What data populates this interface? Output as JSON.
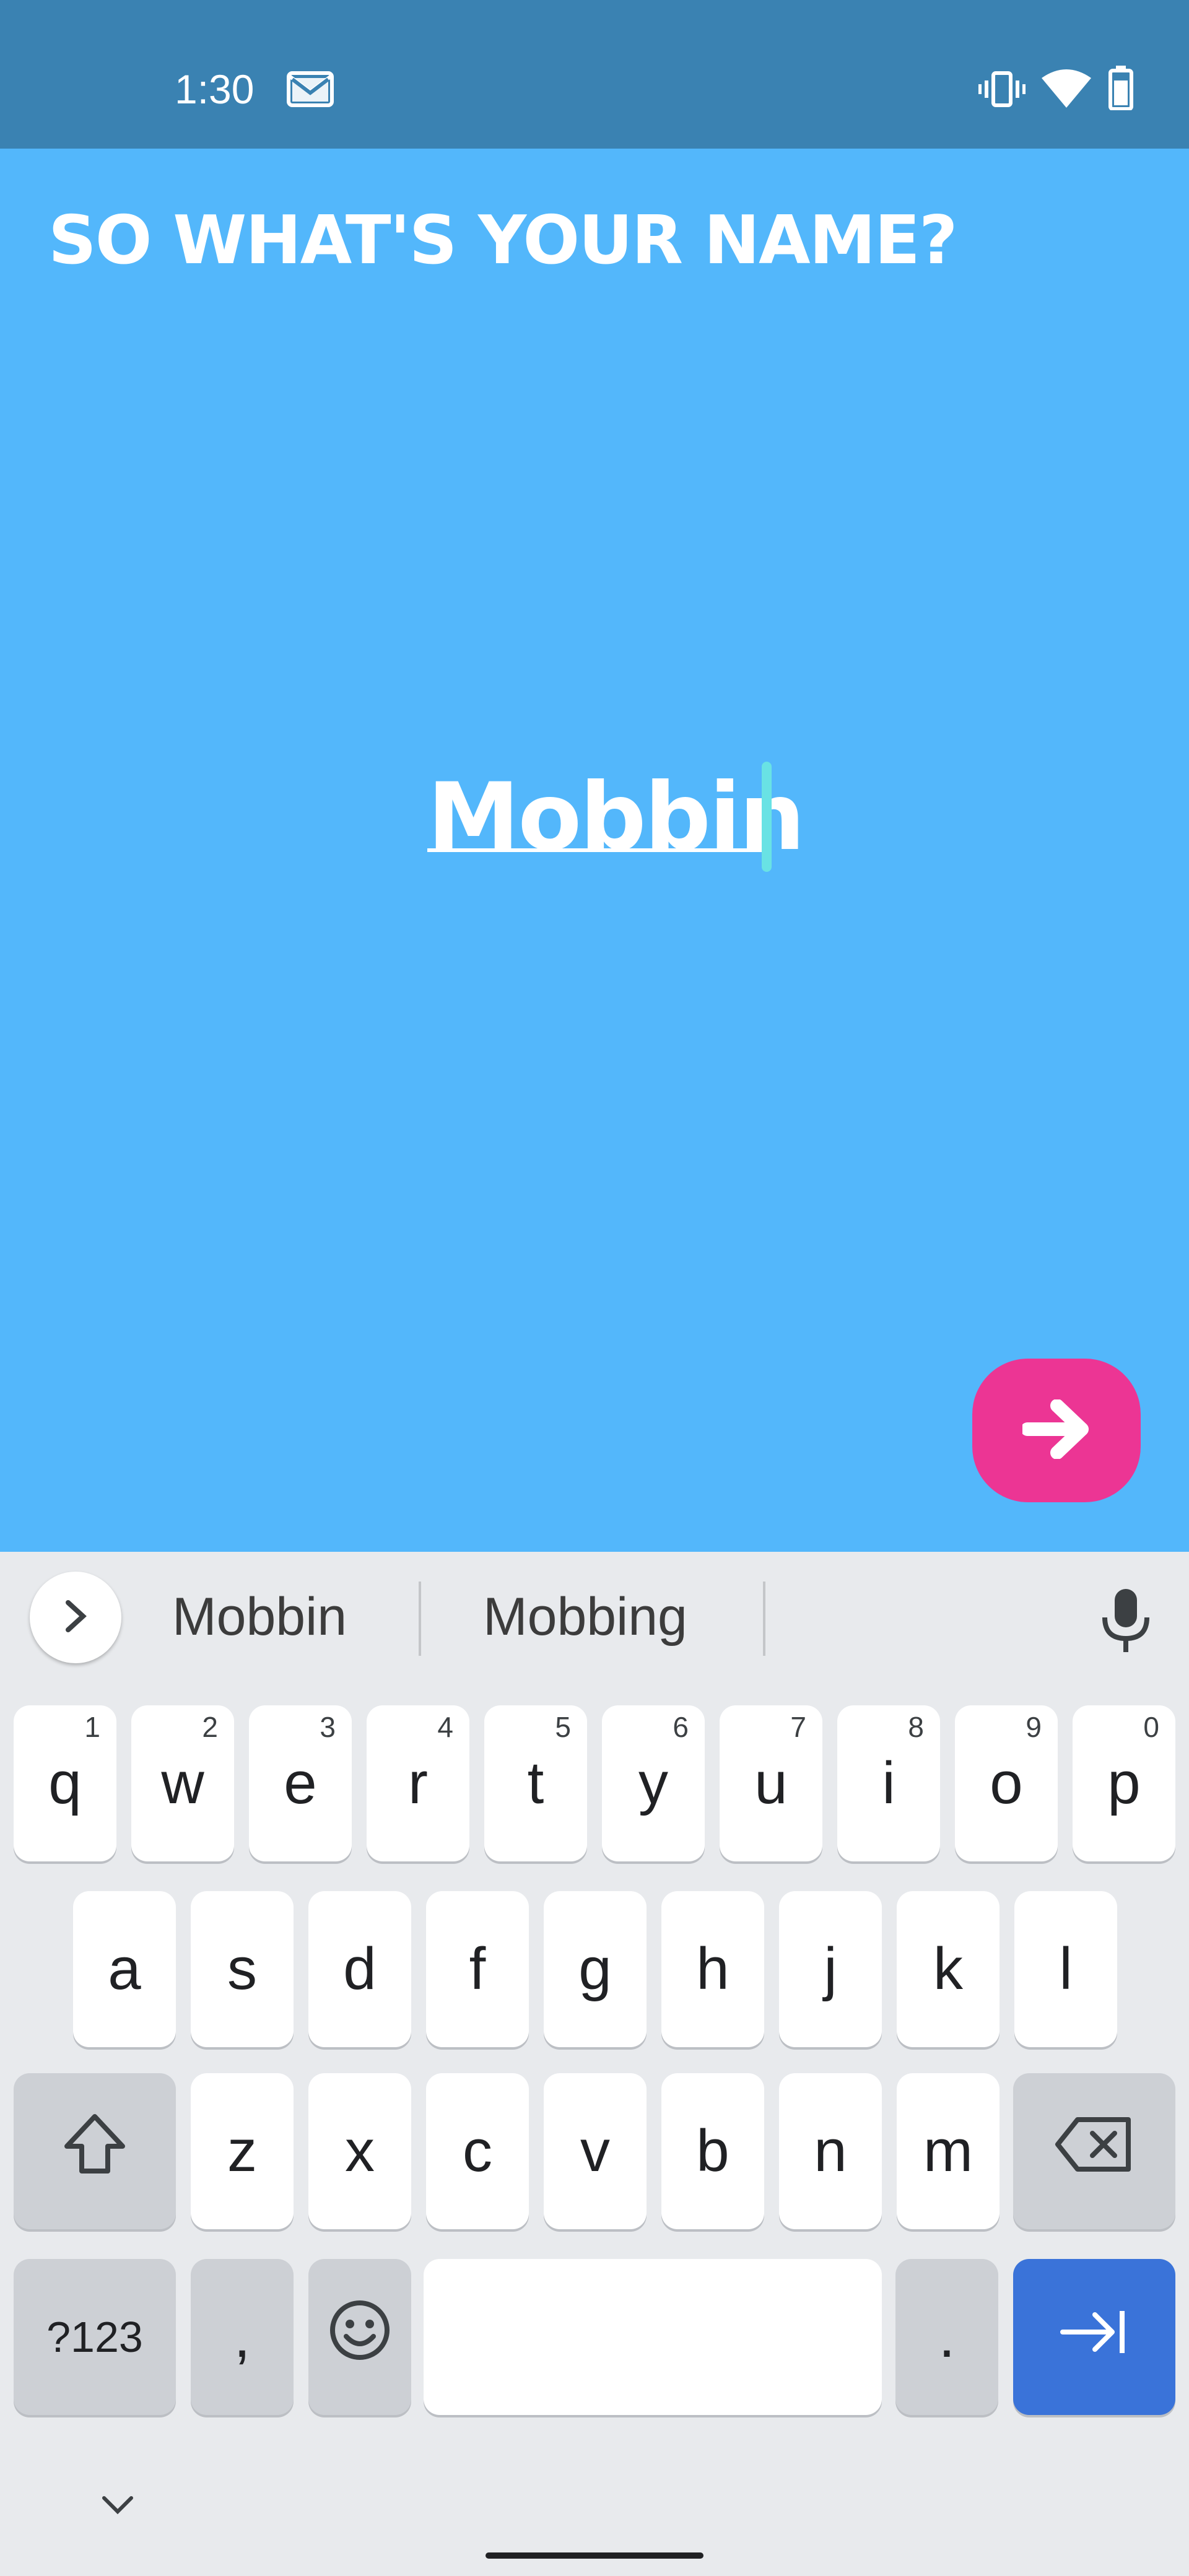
{
  "status_bar": {
    "time": "1:30",
    "icons": [
      "gmail-icon",
      "vibrate-icon",
      "wifi-icon",
      "battery-icon"
    ],
    "color": "#3a82b2"
  },
  "screen": {
    "title": "SO WHAT'S YOUR NAME?",
    "name_value": "Mobbin",
    "background": "#53b7fb",
    "next_button_icon": "arrow-right-icon",
    "next_button_color": "#ec3594"
  },
  "keyboard": {
    "suggestions": [
      "Mobbin",
      "Mobbing"
    ],
    "row1": [
      {
        "label": "q",
        "hint": "1"
      },
      {
        "label": "w",
        "hint": "2"
      },
      {
        "label": "e",
        "hint": "3"
      },
      {
        "label": "r",
        "hint": "4"
      },
      {
        "label": "t",
        "hint": "5"
      },
      {
        "label": "y",
        "hint": "6"
      },
      {
        "label": "u",
        "hint": "7"
      },
      {
        "label": "i",
        "hint": "8"
      },
      {
        "label": "o",
        "hint": "9"
      },
      {
        "label": "p",
        "hint": "0"
      }
    ],
    "row2": [
      "a",
      "s",
      "d",
      "f",
      "g",
      "h",
      "j",
      "k",
      "l"
    ],
    "row3": [
      "z",
      "x",
      "c",
      "v",
      "b",
      "n",
      "m"
    ],
    "symbols_label": "?123",
    "comma_label": ",",
    "period_label": ".",
    "enter_color": "#3a73d9"
  }
}
